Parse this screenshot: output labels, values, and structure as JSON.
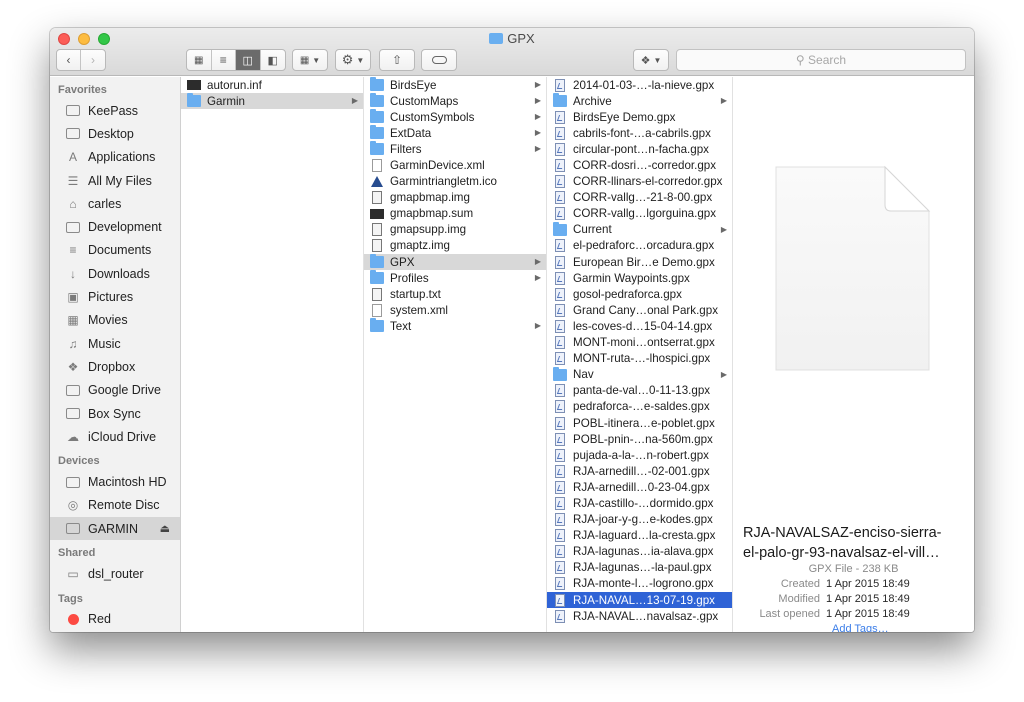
{
  "window": {
    "title": "GPX"
  },
  "toolbar": {
    "search_placeholder": "Search"
  },
  "sidebar": {
    "favorites_header": "Favorites",
    "favorites": [
      {
        "label": "KeePass",
        "icon": "folder-icon"
      },
      {
        "label": "Desktop",
        "icon": "desktop-folder-icon"
      },
      {
        "label": "Applications",
        "icon": "applications-icon"
      },
      {
        "label": "All My Files",
        "icon": "all-files-icon"
      },
      {
        "label": "carles",
        "icon": "home-icon"
      },
      {
        "label": "Development",
        "icon": "folder-icon"
      },
      {
        "label": "Documents",
        "icon": "documents-icon"
      },
      {
        "label": "Downloads",
        "icon": "downloads-icon"
      },
      {
        "label": "Pictures",
        "icon": "pictures-icon"
      },
      {
        "label": "Movies",
        "icon": "movies-icon"
      },
      {
        "label": "Music",
        "icon": "music-icon"
      },
      {
        "label": "Dropbox",
        "icon": "dropbox-icon"
      },
      {
        "label": "Google Drive",
        "icon": "folder-icon"
      },
      {
        "label": "Box Sync",
        "icon": "folder-icon"
      },
      {
        "label": "iCloud Drive",
        "icon": "cloud-icon"
      }
    ],
    "devices_header": "Devices",
    "devices": [
      {
        "label": "Macintosh HD",
        "icon": "hard-disk-icon"
      },
      {
        "label": "Remote Disc",
        "icon": "disc-icon"
      },
      {
        "label": "GARMIN",
        "icon": "external-drive-icon"
      }
    ],
    "shared_header": "Shared",
    "shared": [
      {
        "label": "dsl_router",
        "icon": "monitor-icon"
      }
    ],
    "tags_header": "Tags",
    "tags": [
      {
        "label": "Red",
        "color": "#fc4a42"
      }
    ]
  },
  "columns": {
    "col1": [
      {
        "label": "autorun.inf",
        "type": "black"
      },
      {
        "label": "Garmin",
        "type": "folder",
        "arrow": true,
        "selected": "grey"
      }
    ],
    "col2": [
      {
        "label": "BirdsEye",
        "type": "folder",
        "arrow": true
      },
      {
        "label": "CustomMaps",
        "type": "folder",
        "arrow": true
      },
      {
        "label": "CustomSymbols",
        "type": "folder",
        "arrow": true
      },
      {
        "label": "ExtData",
        "type": "folder",
        "arrow": true
      },
      {
        "label": "Filters",
        "type": "folder",
        "arrow": true
      },
      {
        "label": "GarminDevice.xml",
        "type": "doc"
      },
      {
        "label": "Garmintriangletm.ico",
        "type": "ico"
      },
      {
        "label": "gmapbmap.img",
        "type": "img"
      },
      {
        "label": "gmapbmap.sum",
        "type": "black"
      },
      {
        "label": "gmapsupp.img",
        "type": "img"
      },
      {
        "label": "gmaptz.img",
        "type": "img"
      },
      {
        "label": "GPX",
        "type": "folder",
        "arrow": true,
        "selected": "grey"
      },
      {
        "label": "Profiles",
        "type": "folder",
        "arrow": true
      },
      {
        "label": "startup.txt",
        "type": "img"
      },
      {
        "label": "system.xml",
        "type": "doc"
      },
      {
        "label": "Text",
        "type": "folder",
        "arrow": true
      }
    ],
    "col3": [
      {
        "label": "2014-01-03-…-la-nieve.gpx",
        "type": "gpx"
      },
      {
        "label": "Archive",
        "type": "folder",
        "arrow": true
      },
      {
        "label": "BirdsEye Demo.gpx",
        "type": "gpx"
      },
      {
        "label": "cabrils-font-…a-cabrils.gpx",
        "type": "gpx"
      },
      {
        "label": "circular-pont…n-facha.gpx",
        "type": "gpx"
      },
      {
        "label": "CORR-dosri…-corredor.gpx",
        "type": "gpx"
      },
      {
        "label": "CORR-llinars-el-corredor.gpx",
        "type": "gpx"
      },
      {
        "label": "CORR-vallg…-21-8-00.gpx",
        "type": "gpx"
      },
      {
        "label": "CORR-vallg…lgorguina.gpx",
        "type": "gpx"
      },
      {
        "label": "Current",
        "type": "folder",
        "arrow": true
      },
      {
        "label": "el-pedraforc…orcadura.gpx",
        "type": "gpx"
      },
      {
        "label": "European Bir…e Demo.gpx",
        "type": "gpx"
      },
      {
        "label": "Garmin Waypoints.gpx",
        "type": "gpx"
      },
      {
        "label": "gosol-pedraforca.gpx",
        "type": "gpx"
      },
      {
        "label": "Grand Cany…onal Park.gpx",
        "type": "gpx"
      },
      {
        "label": "les-coves-d…15-04-14.gpx",
        "type": "gpx"
      },
      {
        "label": "MONT-moni…ontserrat.gpx",
        "type": "gpx"
      },
      {
        "label": "MONT-ruta-…-lhospici.gpx",
        "type": "gpx"
      },
      {
        "label": "Nav",
        "type": "folder",
        "arrow": true
      },
      {
        "label": "panta-de-val…0-11-13.gpx",
        "type": "gpx"
      },
      {
        "label": "pedraforca-…e-saldes.gpx",
        "type": "gpx"
      },
      {
        "label": "POBL-itinera…e-poblet.gpx",
        "type": "gpx"
      },
      {
        "label": "POBL-pnin-…na-560m.gpx",
        "type": "gpx"
      },
      {
        "label": "pujada-a-la-…n-robert.gpx",
        "type": "gpx"
      },
      {
        "label": "RJA-arnedill…-02-001.gpx",
        "type": "gpx"
      },
      {
        "label": "RJA-arnedill…0-23-04.gpx",
        "type": "gpx"
      },
      {
        "label": "RJA-castillo-…dormido.gpx",
        "type": "gpx"
      },
      {
        "label": "RJA-joar-y-g…e-kodes.gpx",
        "type": "gpx"
      },
      {
        "label": "RJA-laguard…la-cresta.gpx",
        "type": "gpx"
      },
      {
        "label": "RJA-lagunas…ia-alava.gpx",
        "type": "gpx"
      },
      {
        "label": "RJA-lagunas…-la-paul.gpx",
        "type": "gpx"
      },
      {
        "label": "RJA-monte-l…-logrono.gpx",
        "type": "gpx"
      },
      {
        "label": "RJA-NAVAL…13-07-19.gpx",
        "type": "gpx",
        "selected": "blue"
      },
      {
        "label": "RJA-NAVAL…navalsaz-.gpx",
        "type": "gpx"
      }
    ]
  },
  "preview": {
    "name_line1": "RJA-NAVALSAZ-enciso-sierra-",
    "name_line2": "el-palo-gr-93-navalsaz-el-vill…",
    "kind": "GPX File - 238 KB",
    "created_label": "Created",
    "created_value": "1 Apr 2015 18:49",
    "modified_label": "Modified",
    "modified_value": "1 Apr 2015 18:49",
    "opened_label": "Last opened",
    "opened_value": "1 Apr 2015 18:49",
    "add_tags": "Add Tags…"
  }
}
